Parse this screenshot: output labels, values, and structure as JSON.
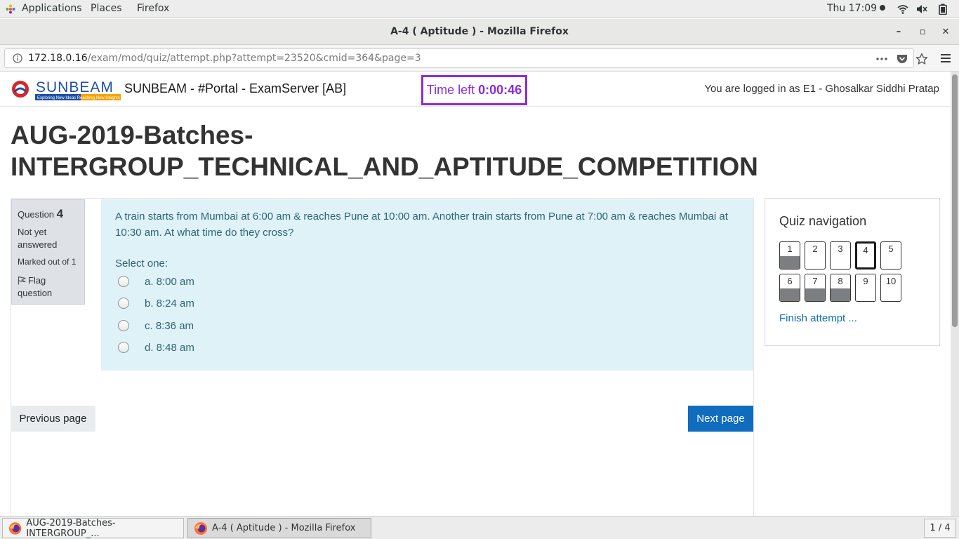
{
  "topbar": {
    "applications": "Applications",
    "places": "Places",
    "firefox": "Firefox",
    "clock": "Thu 17:09"
  },
  "window": {
    "title": "A-4 ( Aptitude ) - Mozilla Firefox",
    "minimize": "–",
    "maximize": "▫",
    "close": "✕"
  },
  "urlbar": {
    "host": "172.18.0.16",
    "path": "/exam/mod/quiz/attempt.php?attempt=23520&cmid=364&page=3"
  },
  "header": {
    "logo_text": "SUNBEAM",
    "logo_tagline": "Exploring New Ideas Reaching New Heights",
    "site_name": "SUNBEAM - #Portal - ExamServer [AB]",
    "timer_label": "Time left",
    "timer_value": "0:00:46",
    "login": "You are logged in as E1 - Ghosalkar Siddhi Pratap"
  },
  "page_heading": "AUG-2019-Batches-INTERGROUP_TECHNICAL_AND_APTITUDE_COMPETITION",
  "question_info": {
    "label": "Question",
    "number": "4",
    "state": "Not yet answered",
    "grade": "Marked out of 1",
    "flag": "Flag question"
  },
  "question": {
    "text": "A train starts from Mumbai at 6:00 am & reaches Pune at 10:00 am. Another train starts from Pune at 7:00 am & reaches Mumbai at 10:30 am. At what time do they cross?",
    "prompt": "Select one:",
    "options": [
      "a. 8:00 am",
      "b. 8:24 am",
      "c. 8:36 am",
      "d. 8:48 am"
    ]
  },
  "buttons": {
    "previous": "Previous page",
    "next": "Next page"
  },
  "quiz_nav": {
    "title": "Quiz navigation",
    "questions": [
      {
        "label": "1",
        "answered": true,
        "current": false
      },
      {
        "label": "2",
        "answered": false,
        "current": false
      },
      {
        "label": "3",
        "answered": false,
        "current": false
      },
      {
        "label": "4",
        "answered": false,
        "current": true
      },
      {
        "label": "5",
        "answered": false,
        "current": false
      },
      {
        "label": "6",
        "answered": true,
        "current": false
      },
      {
        "label": "7",
        "answered": true,
        "current": false
      },
      {
        "label": "8",
        "answered": true,
        "current": false
      },
      {
        "label": "9",
        "answered": false,
        "current": false
      },
      {
        "label": "10",
        "answered": false,
        "current": false
      }
    ],
    "finish": "Finish attempt ..."
  },
  "taskbar": {
    "tasks": [
      "AUG-2019-Batches-INTERGROUP_...",
      "A-4 ( Aptitude ) - Mozilla Firefox"
    ],
    "workspace": "1 / 4"
  },
  "colors": {
    "timer": "#8a2be2",
    "question_bg": "#def2f8",
    "primary_button": "#0f6cbf",
    "answered_fill": "#7c7f82"
  }
}
